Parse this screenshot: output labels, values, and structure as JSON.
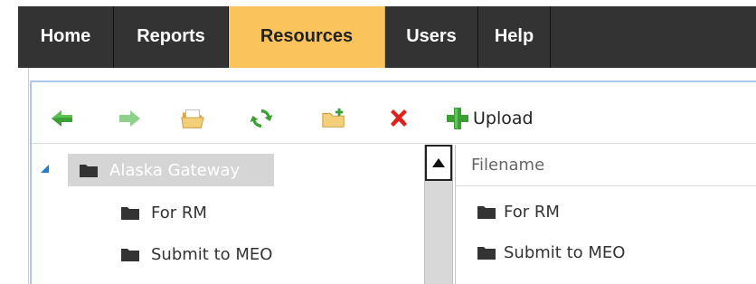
{
  "nav": {
    "tabs": [
      {
        "label": "Home"
      },
      {
        "label": "Reports"
      },
      {
        "label": "Resources",
        "active": true
      },
      {
        "label": "Users"
      },
      {
        "label": "Help"
      }
    ]
  },
  "toolbar": {
    "buttons": [
      {
        "icon": "back-arrow-icon"
      },
      {
        "icon": "forward-arrow-icon"
      },
      {
        "icon": "open-folder-icon"
      },
      {
        "icon": "refresh-icon"
      },
      {
        "icon": "new-folder-icon"
      },
      {
        "icon": "delete-icon"
      }
    ],
    "upload_label": "Upload"
  },
  "tree": {
    "root": {
      "label": "Alaska Gateway",
      "expanded": true,
      "selected": true
    },
    "children": [
      {
        "label": "For RM"
      },
      {
        "label": "Submit to MEO"
      }
    ]
  },
  "grid": {
    "header": "Filename",
    "rows": [
      {
        "filename": "For RM"
      },
      {
        "filename": "Submit to MEO"
      }
    ]
  },
  "colors": {
    "nav_bg": "#333333",
    "nav_active": "#fbc35c",
    "panel_border": "#a9c8ea",
    "arrow_green": "#3aa035",
    "delete_red": "#e0201c",
    "expander_blue": "#1e7fd0"
  }
}
